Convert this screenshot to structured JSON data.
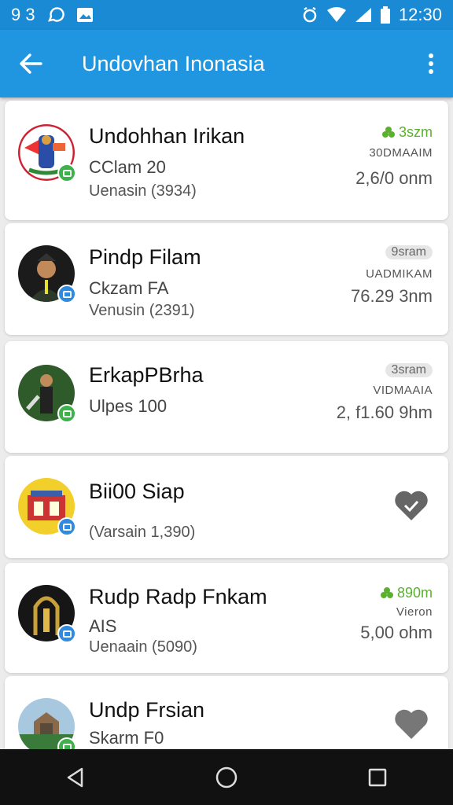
{
  "status_bar": {
    "left_text": "9 3",
    "time": "12:30",
    "icons": [
      "whatsapp-icon",
      "gallery-icon",
      "alarm-icon",
      "wifi-icon",
      "signal-icon",
      "battery-icon"
    ]
  },
  "app_bar": {
    "title": "Undovhan Inonasia",
    "back_icon": "arrow-left-icon",
    "menu_icon": "more-vert-icon"
  },
  "items": [
    {
      "title": "Undohhan Irikan",
      "subtitle": "CClam 20",
      "version": "Uenasin (3934)",
      "badge": "3szm",
      "badge_style": "green",
      "meta": "30DMAAIM",
      "size": "2,6/0 onm",
      "mini_color": "green"
    },
    {
      "title": "Pindp Filam",
      "subtitle": "Ckzam FA",
      "version": "Venusin (2391)",
      "badge": "9sram",
      "badge_style": "grey",
      "meta": "UADMIKAM",
      "size": "76.29 3nm",
      "mini_color": "blue"
    },
    {
      "title": "ErkapPBrha",
      "subtitle": "Ulpes 100",
      "version": "",
      "badge": "3sram",
      "badge_style": "grey",
      "meta": "VIDMAAIA",
      "size": "2, f1.60 9hm",
      "mini_color": "green"
    },
    {
      "title": "Bii00 Siap",
      "subtitle": "",
      "version": "(Varsain 1,390)",
      "badge": "",
      "badge_style": "",
      "meta": "",
      "size": "",
      "mini_color": "blue",
      "action": "heart-check"
    },
    {
      "title": "Rudp Radp Fnkam",
      "subtitle": "AIS",
      "version": "Uenaain (5090)",
      "badge": "890m",
      "badge_style": "green",
      "meta": "Vieron",
      "size": "5,00 ohm",
      "mini_color": "blue"
    },
    {
      "title": "Undp Frsian",
      "subtitle": "Skarm F0",
      "version": "",
      "badge": "",
      "badge_style": "",
      "meta": "",
      "size": "",
      "mini_color": "green",
      "action": "heart"
    }
  ],
  "colors": {
    "status_bar": "#1a8ad4",
    "app_bar": "#2196e0",
    "accent_green": "#5bb030",
    "nav_bar": "#111111"
  },
  "nav": [
    "back-triangle-icon",
    "home-circle-icon",
    "recents-square-icon"
  ]
}
